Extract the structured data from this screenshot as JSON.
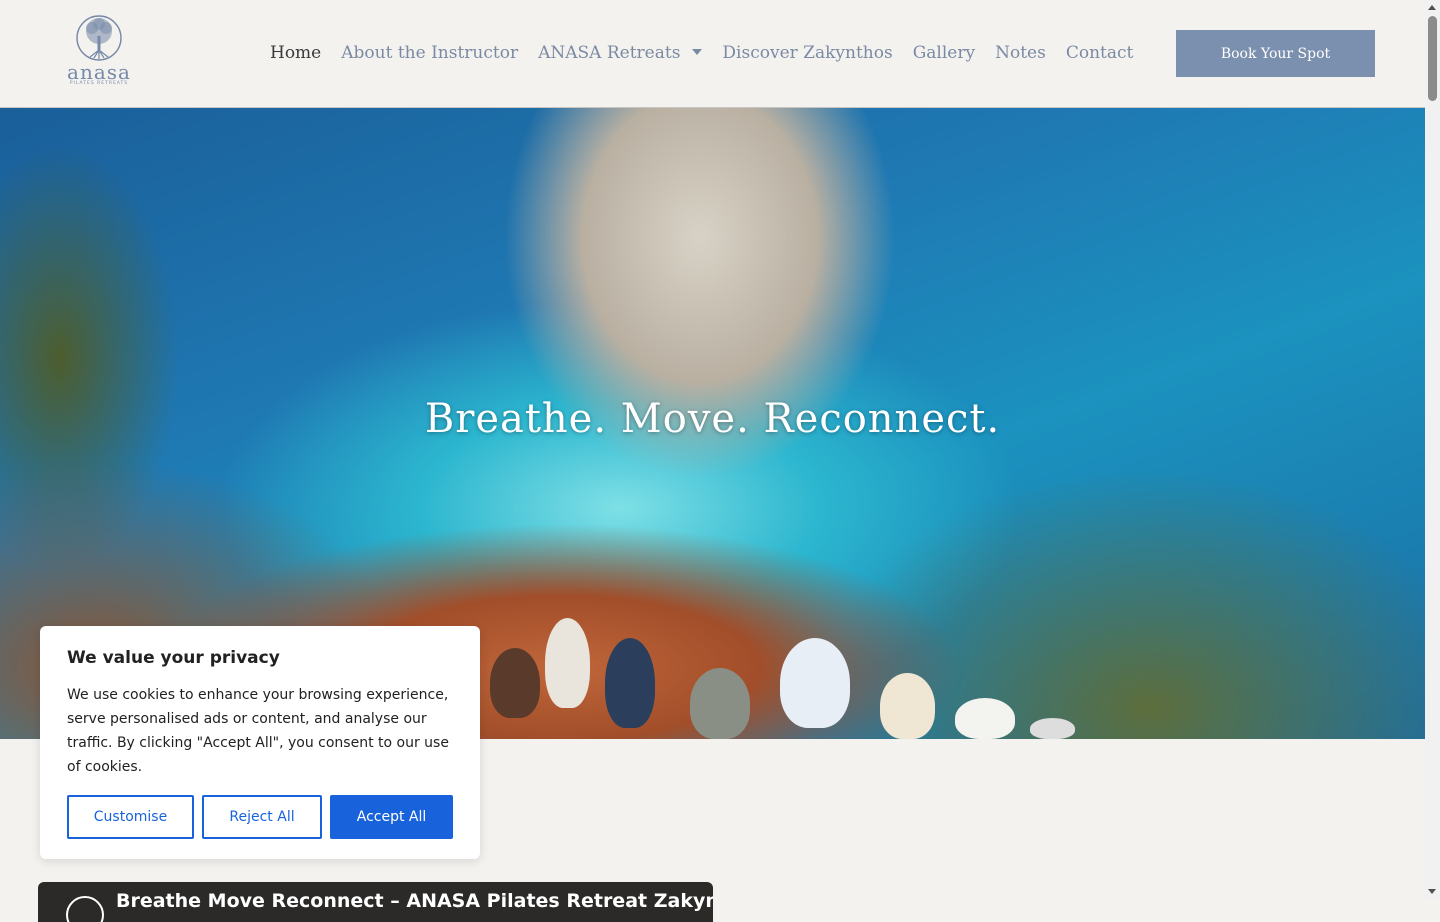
{
  "logo": {
    "word": "anasa",
    "tagline": "PILATES RETREATS",
    "icon": "tree-of-life-icon"
  },
  "nav": {
    "items": [
      {
        "label": "Home",
        "active": true
      },
      {
        "label": "About the Instructor",
        "active": false
      },
      {
        "label": "ANASA Retreats",
        "active": false,
        "has_dropdown": true
      },
      {
        "label": "Discover Zakynthos",
        "active": false
      },
      {
        "label": "Gallery",
        "active": false
      },
      {
        "label": "Notes",
        "active": false
      },
      {
        "label": "Contact",
        "active": false
      }
    ],
    "cta_label": "Book Your Spot"
  },
  "hero": {
    "title": "Breathe. Move. Reconnect."
  },
  "cookie": {
    "title": "We value your privacy",
    "text": "We use cookies to enhance your browsing experience, serve personalised ads or content, and analyse our traffic. By clicking \"Accept All\", you consent to our use of cookies.",
    "customise_label": "Customise",
    "reject_label": "Reject All",
    "accept_label": "Accept All"
  },
  "video": {
    "title": "Breathe Move Reconnect – ANASA Pilates Retreat Zakynthos"
  },
  "colors": {
    "background": "#f4f2ef",
    "nav_text": "#7a8aa3",
    "nav_active": "#3a3a3a",
    "cta_bg": "#7b8fae",
    "cookie_accent": "#1863dc"
  }
}
